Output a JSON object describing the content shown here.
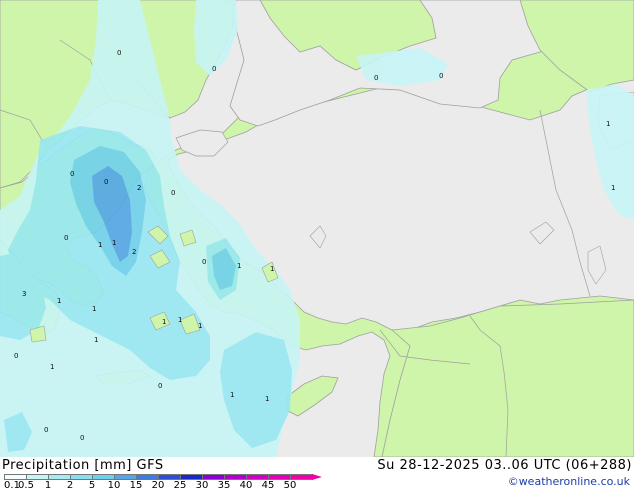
{
  "map": {
    "colors": {
      "sea": "#ebebeb",
      "land": "#cef5a9",
      "border": "#a0a0a0",
      "precip_light": "#c7f5f6",
      "precip_mid": "#98e8f2",
      "precip_high": "#6fd0ec",
      "precip_peak": "#54a6e6"
    },
    "point_values": [
      "0",
      "0",
      "0",
      "0",
      "0",
      "0",
      "0",
      "0",
      "0",
      "1",
      "1",
      "1",
      "1",
      "1",
      "1",
      "1",
      "1",
      "1",
      "1",
      "1",
      "1",
      "1",
      "1",
      "1",
      "2",
      "2",
      "3",
      "0",
      "0",
      "0",
      "0"
    ]
  },
  "legend": {
    "title": "Precipitation [mm]",
    "model": "GFS",
    "ticks": [
      "0.1",
      "0.5",
      "1",
      "2",
      "5",
      "10",
      "15",
      "20",
      "25",
      "30",
      "35",
      "40",
      "45",
      "50"
    ],
    "colors": [
      "#f5fefe",
      "#c7f5f6",
      "#a6ecf3",
      "#86e0f0",
      "#6fd0ec",
      "#54a6e6",
      "#3f7ce0",
      "#2c4fd4",
      "#1a28c6",
      "#8c00d8",
      "#b000d0",
      "#d000c4",
      "#e400b6",
      "#f000a6"
    ]
  },
  "header": {
    "datetime": "Su 28-12-2025 03..06 UTC (06+288)",
    "credit": "©weatheronline.co.uk"
  }
}
